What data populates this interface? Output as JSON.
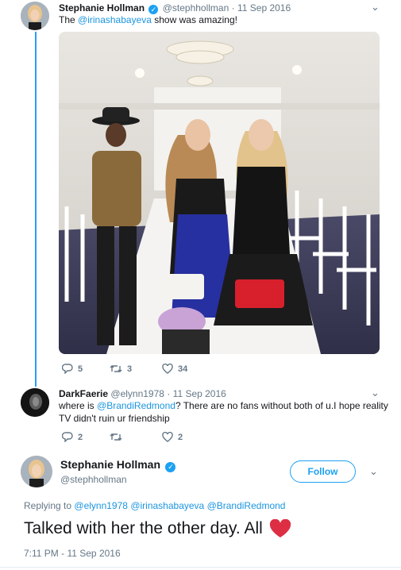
{
  "tweet1": {
    "name": "Stephanie Hollman",
    "handle": "@stephhollman",
    "sep": "·",
    "date": "11 Sep 2016",
    "text_pre": "The ",
    "mention": "@irinashabayeva",
    "text_post": " show was amazing!",
    "replies": "5",
    "retweets": "3",
    "likes": "34"
  },
  "tweet2": {
    "name": "DarkFaerie",
    "handle": "@elynn1978",
    "sep": "·",
    "date": "11 Sep 2016",
    "text_pre": "where is ",
    "mention": "@BrandiRedmond",
    "text_line1_post": "?  There are no fans without both of u.I hope reality",
    "text_line2": "TV didn't ruin ur friendship",
    "replies": "2",
    "likes": "2"
  },
  "main": {
    "name": "Stephanie Hollman",
    "handle": "@stephhollman",
    "follow_label": "Follow",
    "replying_to_label": "Replying to",
    "replying_to": [
      "@elynn1978",
      "@irinashabayeva",
      "@BrandiRedmond"
    ],
    "text": "Talked with her the other day. All",
    "timestamp": "7:11 PM - 11 Sep 2016"
  },
  "colors": {
    "accent": "#1da1f2",
    "thread_line": "#2b9ef0",
    "heart": "#dd2e44"
  }
}
